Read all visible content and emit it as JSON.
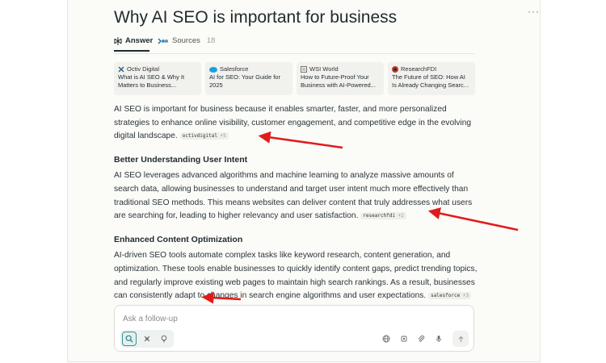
{
  "page": {
    "title": "Why AI SEO is important for business"
  },
  "tabs": {
    "answer_label": "Answer",
    "sources_label": "Sources",
    "sources_count": "18"
  },
  "sources": [
    {
      "site": "Octiv Digital",
      "line1": "What is AI SEO & Why It",
      "line2": "Matters to Business..."
    },
    {
      "site": "Salesforce",
      "line1": "AI for SEO: Your Guide for",
      "line2": "2025"
    },
    {
      "site": "WSI World",
      "line1": "How to Future-Proof Your",
      "line2": "Business with AI-Powered..."
    },
    {
      "site": "ResearchFDI",
      "line1": "The Future of SEO: How AI",
      "line2": "Is Already Changing Searc..."
    }
  ],
  "answer": {
    "intro": "AI SEO is important for business because it enables smarter, faster, and more personalized strategies to enhance online visibility, customer engagement, and competitive edge in the evolving digital landscape.",
    "intro_cite": {
      "name": "octivdigital",
      "count": "+5"
    },
    "section1": {
      "heading": "Better Understanding User Intent",
      "body": "AI SEO leverages advanced algorithms and machine learning to analyze massive amounts of search data, allowing businesses to understand and target user intent much more effectively than traditional SEO methods. This means websites can deliver content that truly addresses what users are searching for, leading to higher relevancy and user satisfaction.",
      "cite": {
        "name": "researchfdi",
        "count": "+2"
      }
    },
    "section2": {
      "heading": "Enhanced Content Optimization",
      "body": "AI-driven SEO tools automate complex tasks like keyword research, content generation, and optimization. These tools enable businesses to quickly identify content gaps, predict trending topics, and regularly improve existing web pages to maintain high search rankings. As a result, businesses can consistently adapt to changes in search engine algorithms and user expectations.",
      "cite": {
        "name": "salesforce",
        "count": "+3"
      }
    }
  },
  "followup": {
    "placeholder": "Ask a follow-up"
  },
  "icons": {
    "answer": "perplexity-logo-icon",
    "sources": "sources-icon",
    "more": "more-dots-icon",
    "search_mode": "search-mode-icon",
    "research_mode": "research-mode-icon",
    "labs_mode": "labs-mode-icon",
    "globe": "globe-icon",
    "focus": "cpu-icon",
    "attach": "paperclip-icon",
    "mic": "microphone-icon",
    "send": "arrow-up-icon"
  },
  "colors": {
    "accent": "#3a8f93",
    "annotation_arrow": "#e01b1b",
    "salesforce": "#1aa0e0",
    "octiv": "#2b5c8a"
  }
}
